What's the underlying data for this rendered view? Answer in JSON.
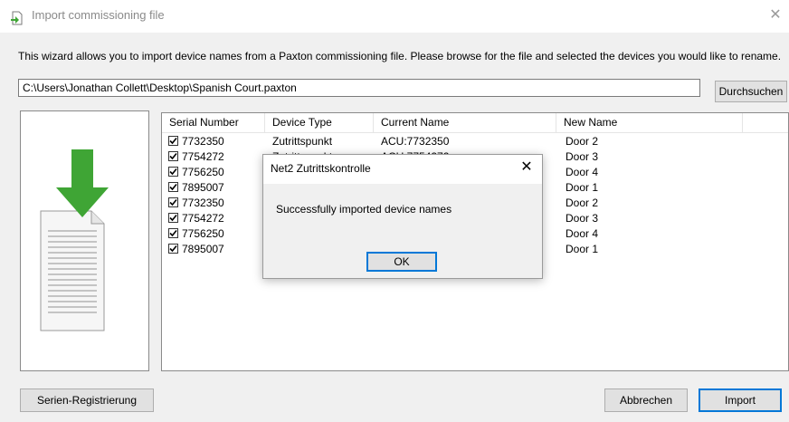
{
  "window": {
    "title": "Import commissioning file"
  },
  "intro_text": "This wizard allows you to import device names from a Paxton commissioning file. Please browse for the file and selected the devices you would like to rename.",
  "file_path": "C:\\Users\\Jonathan Collett\\Desktop\\Spanish Court.paxton",
  "browse_label": "Durchsuchen",
  "columns": [
    "Serial Number",
    "Device Type",
    "Current Name",
    "New Name"
  ],
  "rows": [
    {
      "serial": "7732350",
      "type": "Zutrittspunkt",
      "current": "ACU:7732350",
      "new": "Door 2"
    },
    {
      "serial": "7754272",
      "type": "Zutrittspunkt",
      "current": "ACU:7754272",
      "new": "Door 3"
    },
    {
      "serial": "7756250",
      "type": "",
      "current": "",
      "new": "Door 4"
    },
    {
      "serial": "7895007",
      "type": "",
      "current": "",
      "new": "Door 1"
    },
    {
      "serial": "7732350",
      "type": "",
      "current": "",
      "new": "Door 2"
    },
    {
      "serial": "7754272",
      "type": "",
      "current": "",
      "new": "Door 3"
    },
    {
      "serial": "7756250",
      "type": "",
      "current": "",
      "new": "Door 4"
    },
    {
      "serial": "7895007",
      "type": "",
      "current": "",
      "new": "Door 1"
    }
  ],
  "buttons": {
    "serial": "Serien-Registrierung",
    "cancel": "Abbrechen",
    "import": "Import"
  },
  "dialog": {
    "title": "Net2 Zutrittskontrolle",
    "message": "Successfully imported device names",
    "ok": "OK"
  },
  "colors": {
    "accent": "#0078d7",
    "arrow": "#3fa535"
  }
}
